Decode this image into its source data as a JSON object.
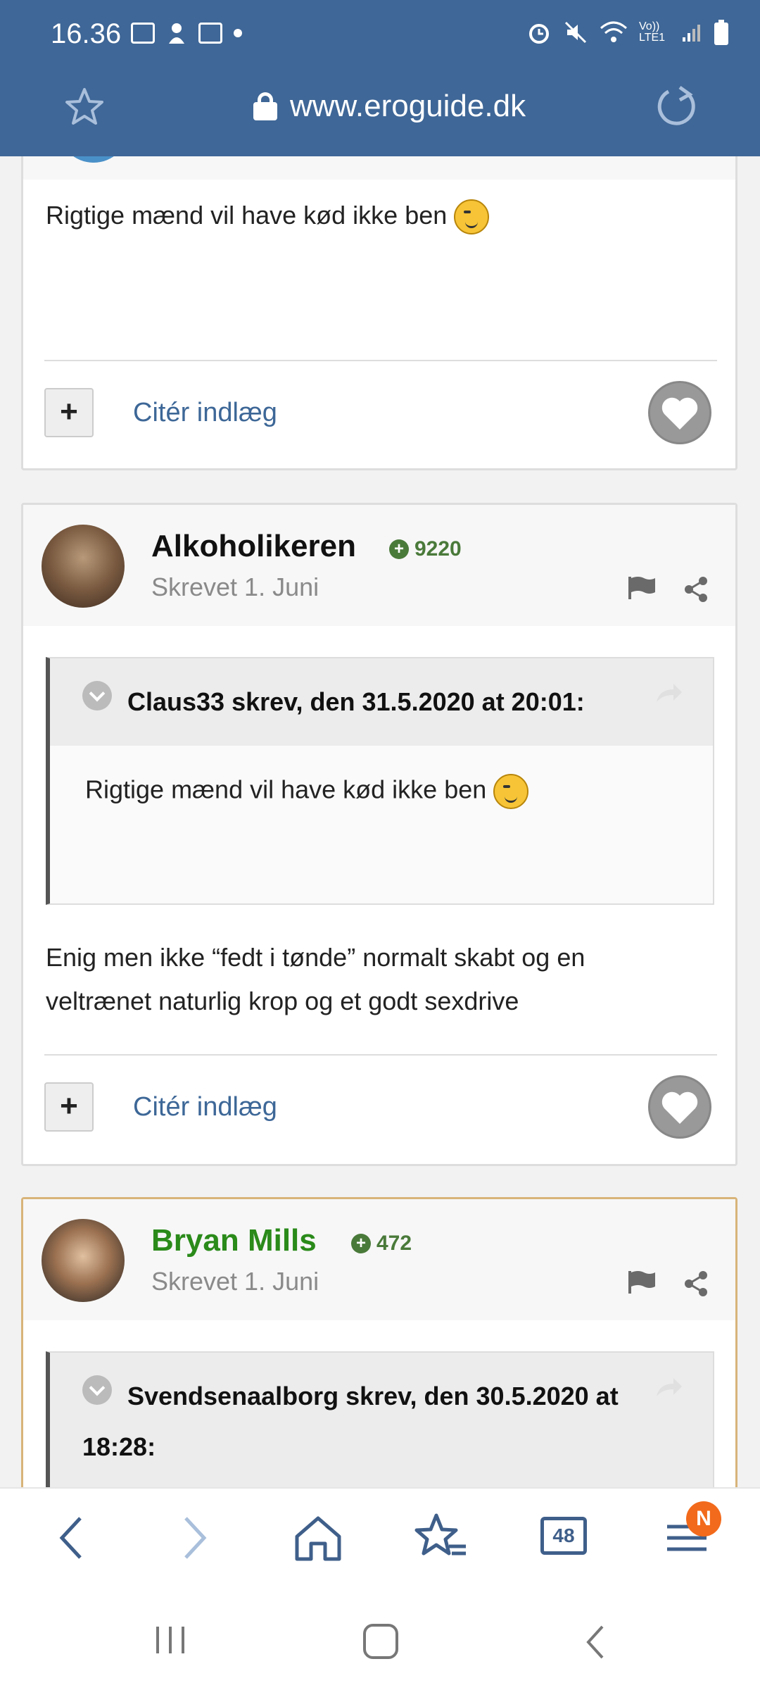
{
  "status_bar": {
    "time": "16.36",
    "network_label": "Vo)) LTE1"
  },
  "browser": {
    "url": "www.eroguide.dk",
    "tab_count": "48",
    "notification_badge": "N"
  },
  "posts": [
    {
      "body": "Rigtige mænd vil have kød ikke ben",
      "quote_label": "Citér indlæg"
    },
    {
      "author": "Alkoholikeren",
      "reputation": "9220",
      "posted": "Skrevet 1. Juni",
      "quote_header": "Claus33 skrev, den 31.5.2020 at 20:01:",
      "quote_body": "Rigtige mænd vil have kød ikke ben",
      "body_line1": "Enig men ikke “fedt i tønde” normalt skabt og en",
      "body_line2": "veltrænet naturlig krop og et godt sexdrive",
      "quote_label": "Citér indlæg"
    },
    {
      "author": "Bryan Mills",
      "reputation": "472",
      "posted": "Skrevet 1. Juni",
      "quote_header_line1": "Svendsenaalborg skrev, den 30.5.2020 at",
      "quote_header_line2": "18:28:"
    }
  ],
  "colors": {
    "topbar": "#3f6797",
    "link": "#3d6797",
    "reputation": "#4a7a3a",
    "author_green": "#2a8a1a",
    "badge": "#f26a1b"
  }
}
